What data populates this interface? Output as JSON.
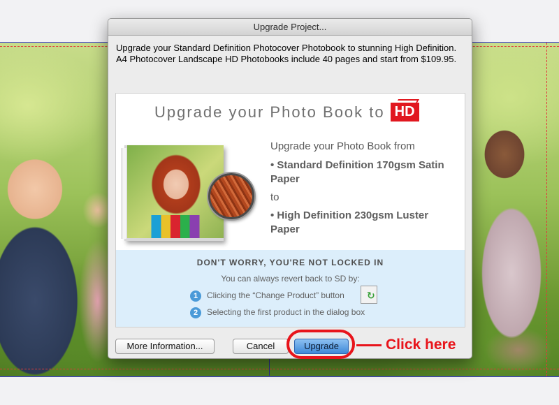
{
  "dialog": {
    "title": "Upgrade Project...",
    "intro_line_1": "Upgrade your Standard Definition Photocover Photobook to stunning High Definition.",
    "intro_line_2": "A4 Photocover Landscape HD Photobooks include 40 pages and start from $109.95."
  },
  "promo": {
    "heading": "Upgrade your Photo Book to",
    "badge": "HD",
    "from_line": "Upgrade your Photo Book from",
    "option_sd": "• Standard Definition 170gsm Satin Paper",
    "to_word": "to",
    "option_hd": "• High Definition 230gsm Luster Paper"
  },
  "notice": {
    "title": "DON'T WORRY, YOU'RE NOT LOCKED IN",
    "subtitle": "You can always revert back to SD by:",
    "steps": [
      {
        "num": "1",
        "text": "Clicking the “Change Product” button"
      },
      {
        "num": "2",
        "text": "Selecting the first product in the dialog box"
      }
    ]
  },
  "buttons": {
    "more_info": "More Information...",
    "cancel": "Cancel",
    "upgrade": "Upgrade"
  },
  "annotation": {
    "label": "Click here",
    "color": "#e8141b"
  },
  "icons": {
    "change_product": "change-product-icon",
    "step_marker": "numbered-circle-icon"
  }
}
